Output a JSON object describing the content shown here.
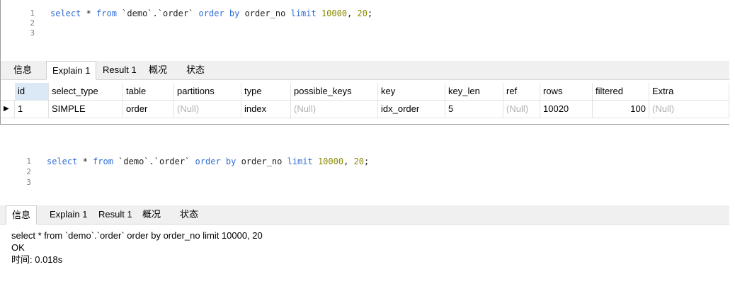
{
  "panel1": {
    "editor": {
      "line_numbers": [
        "1",
        "2",
        "3"
      ],
      "sql_parts": [
        {
          "t": "select",
          "c": "kw"
        },
        {
          "t": " * ",
          "c": "plain"
        },
        {
          "t": "from",
          "c": "kw"
        },
        {
          "t": " `demo`.`order` ",
          "c": "plain"
        },
        {
          "t": "order by",
          "c": "kw"
        },
        {
          "t": " order_no ",
          "c": "plain"
        },
        {
          "t": "limit",
          "c": "kw"
        },
        {
          "t": " 10000",
          "c": "num"
        },
        {
          "t": ", ",
          "c": "plain"
        },
        {
          "t": "20",
          "c": "num"
        },
        {
          "t": ";",
          "c": "plain"
        }
      ]
    },
    "tabs": [
      "信息",
      "Explain 1",
      "Result 1",
      "概况",
      "状态"
    ],
    "active_tab": 1,
    "grid": {
      "columns": [
        "id",
        "select_type",
        "table",
        "partitions",
        "type",
        "possible_keys",
        "key",
        "key_len",
        "ref",
        "rows",
        "filtered",
        "Extra"
      ],
      "row_marker": "▶",
      "rows": [
        [
          "1",
          "SIMPLE",
          "order",
          "(Null)",
          "index",
          "(Null)",
          "idx_order",
          "5",
          "(Null)",
          "10020",
          "100",
          "(Null)"
        ]
      ]
    }
  },
  "panel2": {
    "editor": {
      "line_numbers": [
        "1",
        "2",
        "3"
      ],
      "sql_parts": [
        {
          "t": "select",
          "c": "kw"
        },
        {
          "t": " * ",
          "c": "plain"
        },
        {
          "t": "from",
          "c": "kw"
        },
        {
          "t": " `demo`.`order` ",
          "c": "plain"
        },
        {
          "t": "order by",
          "c": "kw"
        },
        {
          "t": " order_no ",
          "c": "plain"
        },
        {
          "t": "limit",
          "c": "kw"
        },
        {
          "t": " 10000",
          "c": "num"
        },
        {
          "t": ", ",
          "c": "plain"
        },
        {
          "t": "20",
          "c": "num"
        },
        {
          "t": ";",
          "c": "plain"
        }
      ]
    },
    "tabs": [
      "信息",
      "Explain 1",
      "Result 1",
      "概况",
      "状态"
    ],
    "active_tab": 0,
    "info": {
      "query": "select * from `demo`.`order` order by order_no limit 10000, 20",
      "status": "OK",
      "time": "时间: 0.018s"
    }
  }
}
